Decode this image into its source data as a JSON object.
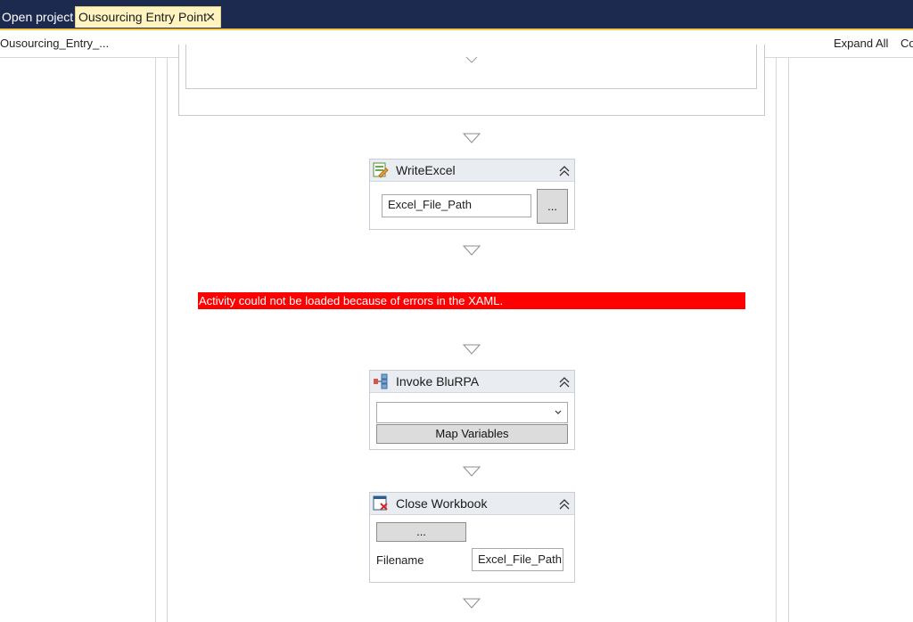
{
  "tabs": {
    "open_project": "Open project",
    "active": "Ousourcing Entry Point",
    "close_glyph": "✕"
  },
  "toolbar": {
    "breadcrumb": "Ousourcing_Entry_...",
    "expand_all": "Expand All",
    "collapse_all": "Collapse All"
  },
  "write_excel": {
    "title": "WriteExcel",
    "file_value": "Excel_File_Path",
    "browse_label": "..."
  },
  "error": {
    "message": "Activity could not be loaded because of errors in the XAML."
  },
  "invoke": {
    "title": "Invoke BluRPA",
    "select_value": "",
    "map_label": "Map Variables"
  },
  "close_workbook": {
    "title": "Close Workbook",
    "browse_label": "...",
    "filename_label": "Filename",
    "filename_value": "Excel_File_Path"
  },
  "colors": {
    "tab_bar": "#1c2a4f",
    "active_tab": "#fff4bf",
    "error": "#ff0000"
  },
  "icons": [
    "close-icon",
    "write-excel-icon",
    "invoke-icon",
    "close-workbook-icon",
    "collapse-icon",
    "chevron-down-icon",
    "arrow-down-icon"
  ]
}
